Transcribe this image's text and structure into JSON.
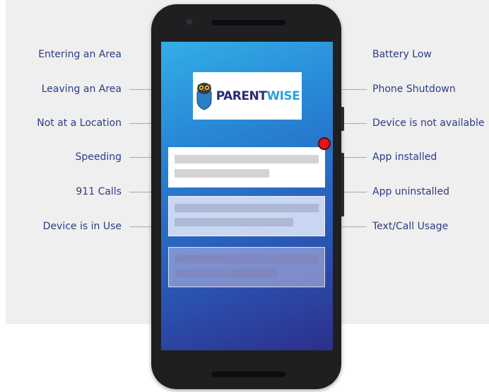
{
  "left_alerts": [
    "Entering an Area",
    "Leaving an Area",
    "Not at a Location",
    "Speeding",
    "911 Calls",
    "Device is in Use"
  ],
  "right_alerts": [
    "Battery Low",
    "Phone Shutdown",
    "Device is not available",
    "App installed",
    "App uninstalled",
    "Text/Call Usage"
  ],
  "logo": {
    "part1": "PARENT",
    "part2": "WISE",
    "brand_color": "#2a2a78",
    "accent_color": "#2ba0dc"
  },
  "icons": {
    "logo_mark": "owl-shield-icon",
    "notification": "notification-dot-icon"
  },
  "colors": {
    "label_text": "#2e3b84",
    "notification_dot": "#e8131a",
    "screen_top": "#33aee6",
    "screen_bottom": "#2d2f8c"
  }
}
